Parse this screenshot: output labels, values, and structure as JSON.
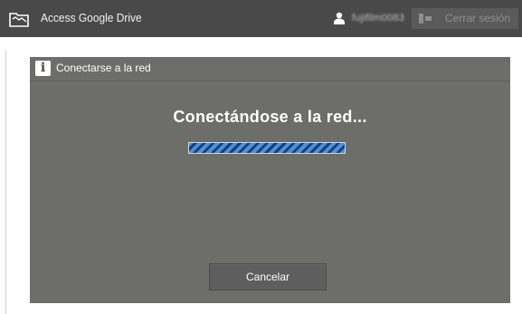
{
  "header": {
    "app_title": "Access Google Drive",
    "app_icon": "folder-icon",
    "user_icon": "user-icon",
    "user_name": "fujifilm0083",
    "logout_icon": "logout-icon",
    "logout_label": "Cerrar sesión"
  },
  "dialog": {
    "header_icon": "info-icon",
    "header_icon_glyph": "i",
    "title": "Conectarse a la red",
    "message": "Conectándose a la red...",
    "progress": 1.0,
    "cancel_label": "Cancelar"
  },
  "colors": {
    "titlebar": "#494949",
    "dialog_background": "#6d6e6a",
    "progress_stripe": "#4f8fd8"
  }
}
